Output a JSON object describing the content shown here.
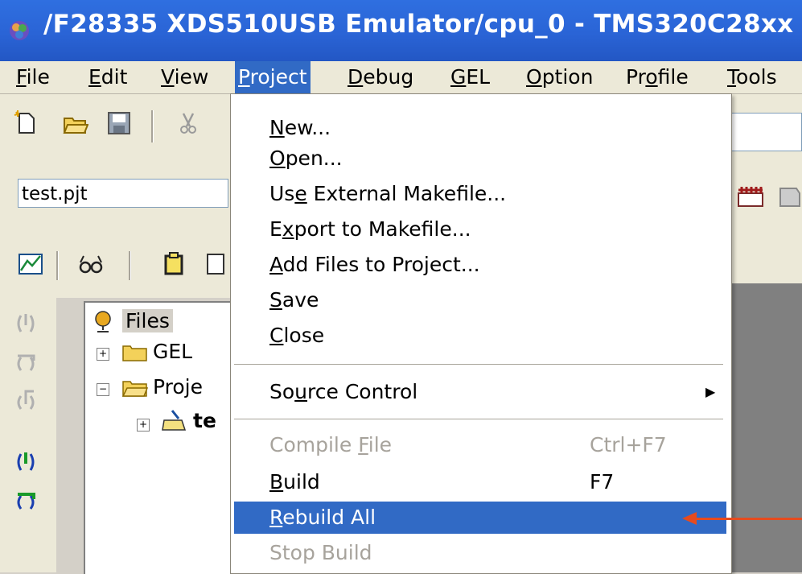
{
  "window": {
    "title": "/F28335 XDS510USB Emulator/cpu_0 - TMS320C28xx"
  },
  "menubar": {
    "items": [
      {
        "label": "File",
        "ul": "F",
        "rest": "ile"
      },
      {
        "label": "Edit",
        "ul": "E",
        "rest": "dit"
      },
      {
        "label": "View",
        "ul": "V",
        "rest": "iew"
      },
      {
        "label": "Project",
        "ul": "P",
        "rest": "roject"
      },
      {
        "label": "Debug",
        "ul": "D",
        "rest": "ebug"
      },
      {
        "label": "GEL",
        "ul": "G",
        "rest": "EL"
      },
      {
        "label": "Option",
        "ul": "O",
        "rest": "ption"
      },
      {
        "label": "Profile",
        "pre": "Pr",
        "ul": "o",
        "rest": "file"
      },
      {
        "label": "Tools",
        "ul": "T",
        "rest": "ools"
      }
    ]
  },
  "toolbar": {
    "project_combo_value": "test.pjt"
  },
  "tree": {
    "root": "Files",
    "gel": "GEL",
    "projects": "Proje",
    "project_item": "te"
  },
  "dropdown": {
    "items": [
      {
        "pre": "",
        "ul": "N",
        "rest": "ew...",
        "shortcut": ""
      },
      {
        "pre": "",
        "ul": "O",
        "rest": "pen...",
        "shortcut": ""
      },
      {
        "pre": "Us",
        "ul": "e",
        "rest": " External Makefile...",
        "shortcut": ""
      },
      {
        "pre": "E",
        "ul": "x",
        "rest": "port to Makefile...",
        "shortcut": ""
      },
      {
        "pre": "",
        "ul": "A",
        "rest": "dd Files to Project...",
        "shortcut": ""
      },
      {
        "pre": "",
        "ul": "S",
        "rest": "ave",
        "shortcut": ""
      },
      {
        "pre": "",
        "ul": "C",
        "rest": "lose",
        "shortcut": ""
      },
      {
        "pre": "So",
        "ul": "u",
        "rest": "rce Control",
        "shortcut": "",
        "submenu": "▶"
      },
      {
        "pre": "Compile ",
        "ul": "F",
        "rest": "ile",
        "shortcut": "Ctrl+F7",
        "disabled": true
      },
      {
        "pre": "",
        "ul": "B",
        "rest": "uild",
        "shortcut": "F7"
      },
      {
        "pre": "",
        "ul": "R",
        "rest": "ebuild All",
        "shortcut": "",
        "highlighted": true
      },
      {
        "pre": "Stop Build",
        "ul": "",
        "rest": "",
        "shortcut": "",
        "disabled": true
      }
    ]
  },
  "colors": {
    "title_bar": "#2a64d6",
    "menu_highlight": "#316ac5",
    "arrow": "#e64b1e"
  }
}
